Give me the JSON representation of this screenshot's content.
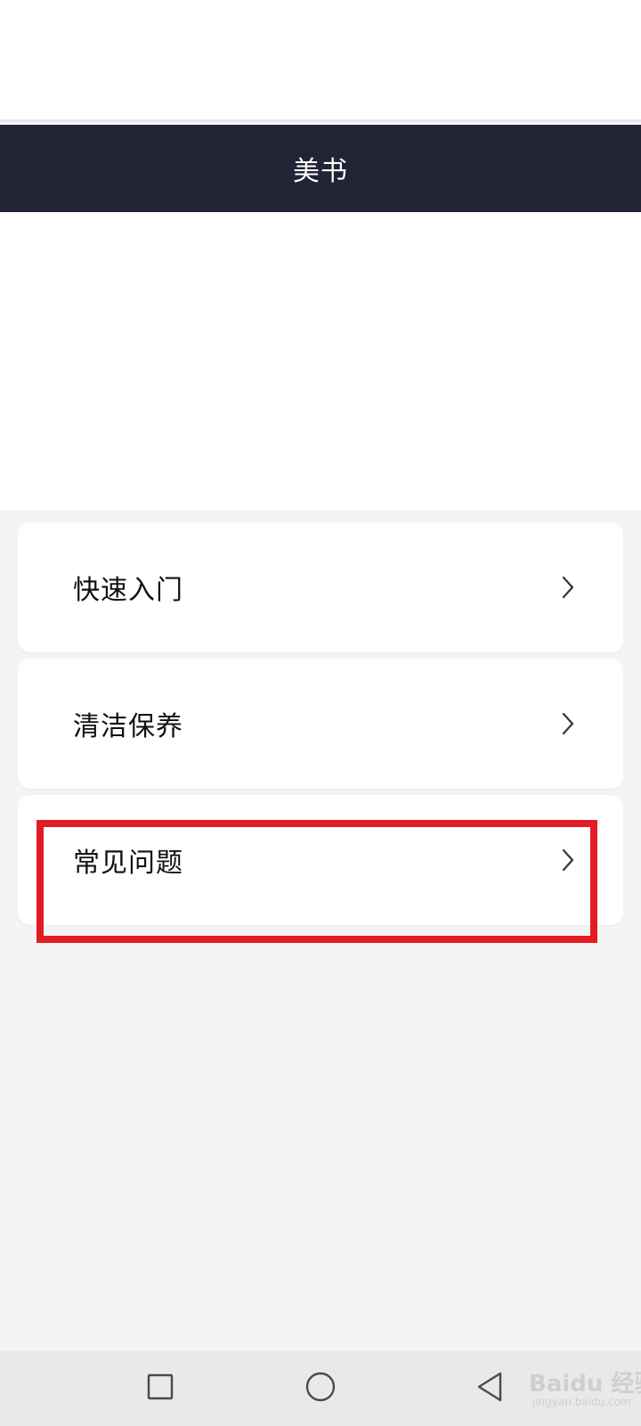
{
  "header": {
    "title": "美书"
  },
  "menu": {
    "items": [
      {
        "label": "快速入门",
        "icon": "chevron-right-icon"
      },
      {
        "label": "清洁保养",
        "icon": "chevron-right-icon"
      },
      {
        "label": "常见问题",
        "icon": "chevron-right-icon"
      }
    ]
  },
  "annotation": {
    "highlighted_item": "常见问题",
    "color": "#e31b23"
  },
  "nav_bar": {
    "buttons": [
      "recent-apps-icon",
      "home-icon",
      "back-icon"
    ]
  },
  "watermark": {
    "main": "Baidu 经验",
    "sub": "jingyan.baidu.com"
  },
  "colors": {
    "header_bg": "#222334",
    "page_bg": "#f4f4f4",
    "card_bg": "#ffffff"
  }
}
